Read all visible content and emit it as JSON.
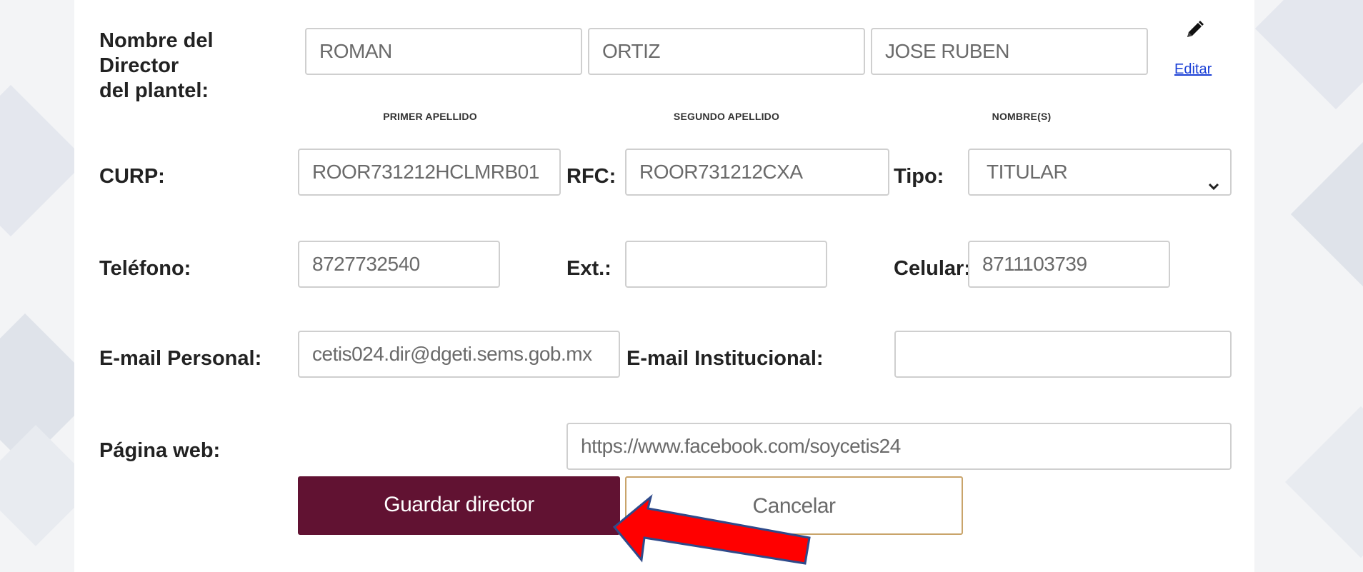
{
  "form": {
    "director_label": "Nombre del Director\ndel plantel:",
    "director": {
      "primer_apellido": "ROMAN",
      "segundo_apellido": "ORTIZ",
      "nombres": "JOSE RUBEN"
    },
    "edit_link": "Editar",
    "sublabels": {
      "primer_apellido": "PRIMER APELLIDO",
      "segundo_apellido": "SEGUNDO APELLIDO",
      "nombres": "NOMBRE(S)"
    },
    "curp_label": "CURP:",
    "curp_value": "ROOR731212HCLMRB01",
    "rfc_label": "RFC:",
    "rfc_value": "ROOR731212CXA",
    "tipo_label": "Tipo:",
    "tipo_value": "TITULAR",
    "telefono_label": "Teléfono:",
    "telefono_value": "8727732540",
    "ext_label": "Ext.:",
    "ext_value": "",
    "celular_label": "Celular:",
    "celular_value": "8711103739",
    "email_personal_label": "E-mail Personal:",
    "email_personal_value": "cetis024.dir@dgeti.sems.gob.mx",
    "email_institucional_label": "E-mail Institucional:",
    "email_institucional_value": "",
    "pagina_web_label": "Página web:",
    "pagina_web_value": "https://www.facebook.com/soycetis24",
    "save_button": "Guardar director",
    "cancel_button": "Cancelar"
  },
  "colors": {
    "primary": "#611232",
    "cancel_border": "#c9a46a",
    "arrow_fill": "#ff0000",
    "arrow_stroke": "#2f4a8a",
    "link": "#1a3fd6"
  }
}
